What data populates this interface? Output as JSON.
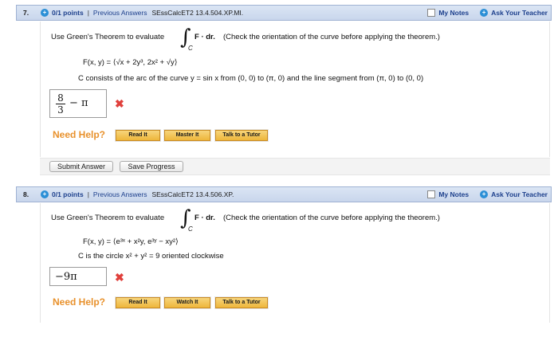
{
  "questions": [
    {
      "number": "7.",
      "points": "0/1 points",
      "separator": "|",
      "previous_answers": "Previous Answers",
      "code": "SEssCalcET2 13.4.504.XP.MI.",
      "my_notes": "My Notes",
      "ask_teacher": "Ask Your Teacher",
      "prompt_lead": "Use Green's Theorem to evaluate",
      "integrand": "F · dr.",
      "prompt_tail": "(Check the orientation of the curve before applying the theorem.)",
      "integral_symbol": "∫",
      "integral_sub": "C",
      "field": "F(x, y) = ⟨√x + 2y³, 2x² + √y⟩",
      "curve": "C consists of the arc of the curve y = sin x from (0, 0) to (π, 0) and the line segment from (π, 0) to (0, 0)",
      "answer_num": "8",
      "answer_den": "3",
      "answer_rest": "− π",
      "wrong_mark": "✖",
      "need_help": "Need Help?",
      "help_buttons": [
        "Read It",
        "Master It",
        "Talk to a Tutor"
      ],
      "submit": "Submit Answer",
      "save": "Save Progress"
    },
    {
      "number": "8.",
      "points": "0/1 points",
      "separator": "|",
      "previous_answers": "Previous Answers",
      "code": "SEssCalcET2 13.4.506.XP.",
      "my_notes": "My Notes",
      "ask_teacher": "Ask Your Teacher",
      "prompt_lead": "Use Green's Theorem to evaluate",
      "integrand": "F · dr.",
      "prompt_tail": "(Check the orientation of the curve before applying the theorem.)",
      "integral_symbol": "∫",
      "integral_sub": "C",
      "field": "F(x, y) = ⟨e³ˣ + x²y, e³ʸ − xy²⟩",
      "curve": "C is the circle x² + y² = 9 oriented clockwise",
      "answer": "−9π",
      "wrong_mark": "✖",
      "need_help": "Need Help?",
      "help_buttons": [
        "Read It",
        "Watch It",
        "Talk to a Tutor"
      ]
    }
  ],
  "colors": {
    "header_bg": "#c9d6ec",
    "link": "#1c3f8c",
    "help": "#e8912c",
    "wrong": "#e0403c",
    "button_gold": "#eeb63b"
  }
}
